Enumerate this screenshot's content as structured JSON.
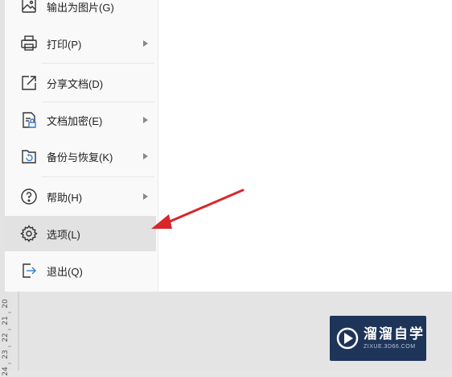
{
  "menu": {
    "items": [
      {
        "label": "输出为图片(G)",
        "icon": "image-export-icon",
        "submenu": false
      },
      {
        "label": "打印(P)",
        "icon": "printer-icon",
        "submenu": true
      },
      {
        "label": "分享文档(D)",
        "icon": "share-icon",
        "submenu": false
      },
      {
        "label": "文档加密(E)",
        "icon": "lock-document-icon",
        "submenu": true
      },
      {
        "label": "备份与恢复(K)",
        "icon": "backup-restore-icon",
        "submenu": true
      },
      {
        "label": "帮助(H)",
        "icon": "help-icon",
        "submenu": true
      },
      {
        "label": "选项(L)",
        "icon": "gear-icon",
        "submenu": false,
        "selected": true
      },
      {
        "label": "退出(Q)",
        "icon": "exit-icon",
        "submenu": false
      }
    ]
  },
  "ruler": {
    "numbers": [
      "20",
      "21",
      "22",
      "23",
      "24"
    ]
  },
  "watermark": {
    "title": "溜溜自学",
    "url": "ZIXUE.3D66.COM"
  },
  "colors": {
    "arrow": "#d9262b",
    "selected_bg": "#e2e2e2",
    "logo_bg": "#1e3458"
  }
}
